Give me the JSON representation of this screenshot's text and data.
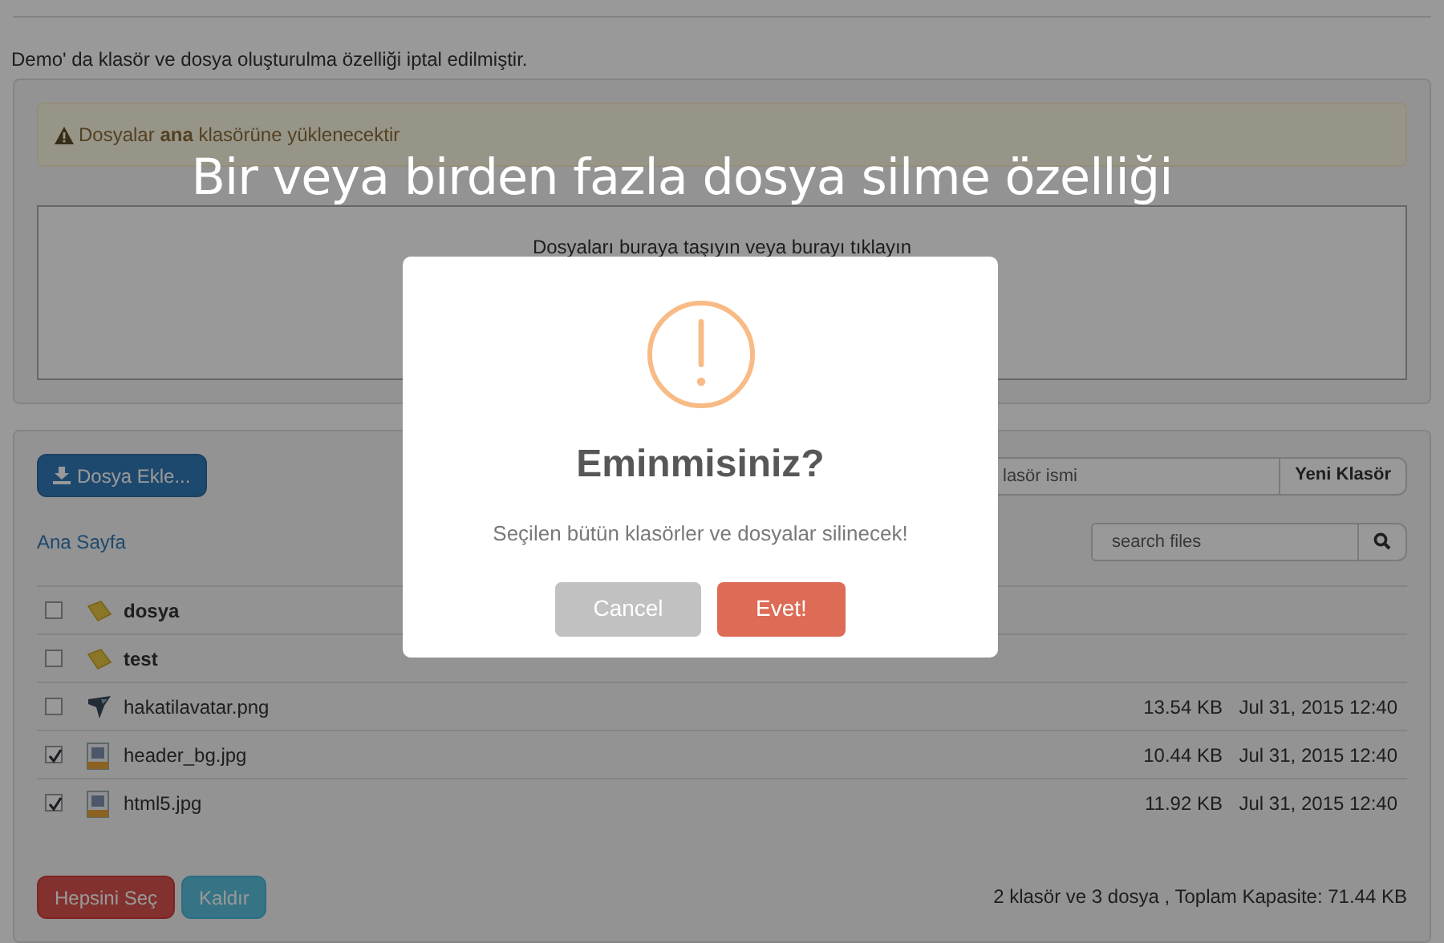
{
  "notice": "Demo' da klasör ve dosya oluşturulma özelliği iptal edilmiştir.",
  "upload_panel": {
    "alert": "Dosyalar **ana** klasörüne yüklenecektir",
    "dropzone": "Dosyaları buraya taşıyın veya burayı tıklayın"
  },
  "caption": "Bir veya birden fazla dosya silme özelliği",
  "file_panel": {
    "add_button": "Dosya Ekle...",
    "folder_name": {
      "placeholder": "lasör ismi"
    },
    "new_folder_button": "Yeni Klasör",
    "breadcrumb": "Ana Sayfa",
    "search": {
      "placeholder": "search files"
    },
    "rows": [
      {
        "kind": "folder",
        "name": "dosya",
        "checked": false
      },
      {
        "kind": "folder",
        "name": "test",
        "checked": false
      },
      {
        "kind": "image",
        "name": "hakatilavatar.png",
        "size": "13.54 KB",
        "date": "Jul 31, 2015 12:40",
        "checked": false
      },
      {
        "kind": "jpg",
        "name": "header_bg.jpg",
        "size": "10.44 KB",
        "date": "Jul 31, 2015 12:40",
        "checked": true
      },
      {
        "kind": "jpg",
        "name": "html5.jpg",
        "size": "11.92 KB",
        "date": "Jul 31, 2015 12:40",
        "checked": true
      }
    ],
    "select_all_button": "Hepsini Seç",
    "remove_button": "Kaldır",
    "summary": "2 klasör ve 3 dosya , Toplam Kapasite: 71.44 KB"
  },
  "dialog": {
    "title": "Eminmisiniz?",
    "message": "Seçilen bütün klasörler ve dosyalar silinecek!",
    "buttons": [
      {
        "kind": "cancel",
        "label": "Cancel"
      },
      {
        "kind": "confirm",
        "label": "Evet!"
      }
    ]
  }
}
